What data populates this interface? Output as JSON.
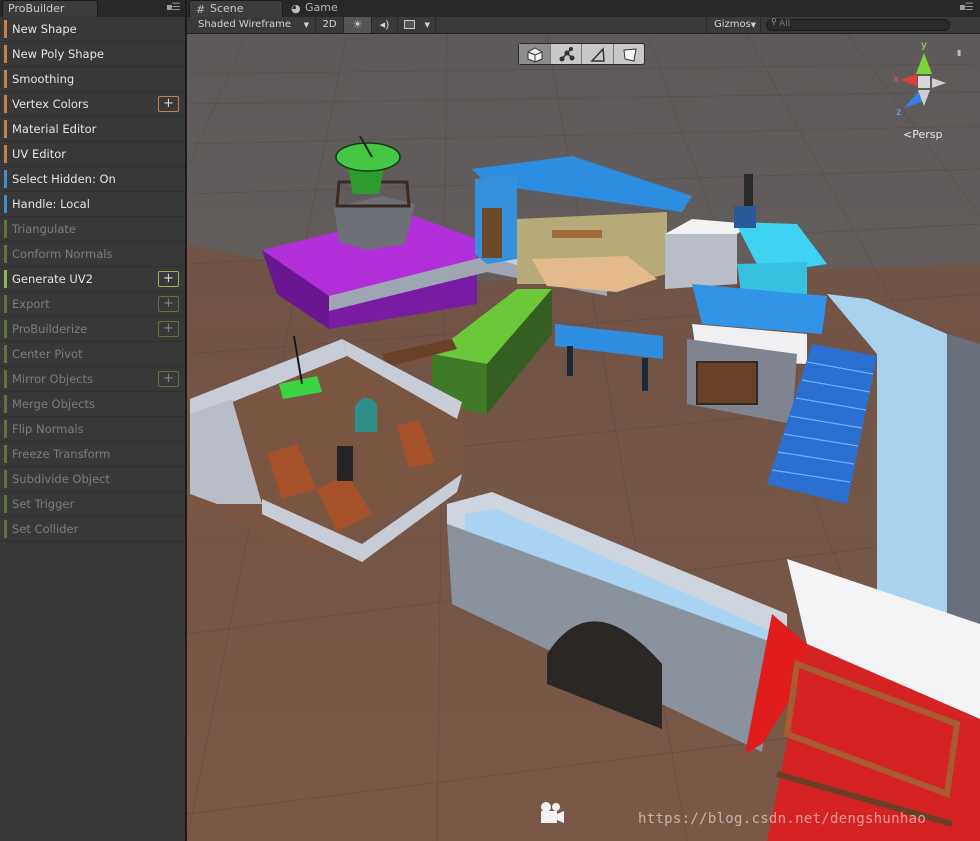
{
  "probuilder": {
    "title": "ProBuilder",
    "items": [
      {
        "label": "New Shape",
        "color": "#c9804a",
        "plus": false,
        "enabled": true
      },
      {
        "label": "New Poly Shape",
        "color": "#c9804a",
        "plus": false,
        "enabled": true
      },
      {
        "label": "Smoothing",
        "color": "#c9804a",
        "plus": false,
        "enabled": true
      },
      {
        "label": "Vertex Colors",
        "color": "#c9804a",
        "plus": true,
        "enabled": true
      },
      {
        "label": "Material Editor",
        "color": "#c9804a",
        "plus": false,
        "enabled": true
      },
      {
        "label": "UV Editor",
        "color": "#c9804a",
        "plus": false,
        "enabled": true
      },
      {
        "label": "Select Hidden: On",
        "color": "#3d8fcf",
        "plus": false,
        "enabled": true
      },
      {
        "label": "Handle: Local",
        "color": "#3d8fcf",
        "plus": false,
        "enabled": true
      },
      {
        "label": "Triangulate",
        "color": "#8fb84e",
        "plus": false,
        "enabled": false
      },
      {
        "label": "Conform Normals",
        "color": "#8fb84e",
        "plus": false,
        "enabled": false
      },
      {
        "label": "Generate UV2",
        "color": "#8fb84e",
        "plus": true,
        "enabled": true
      },
      {
        "label": "Export",
        "color": "#8fb84e",
        "plus": true,
        "enabled": false
      },
      {
        "label": "ProBuilderize",
        "color": "#8fb84e",
        "plus": true,
        "enabled": false
      },
      {
        "label": "Center Pivot",
        "color": "#8fb84e",
        "plus": false,
        "enabled": false
      },
      {
        "label": "Mirror Objects",
        "color": "#8fb84e",
        "plus": true,
        "enabled": false
      },
      {
        "label": "Merge Objects",
        "color": "#8fb84e",
        "plus": false,
        "enabled": false
      },
      {
        "label": "Flip Normals",
        "color": "#8fb84e",
        "plus": false,
        "enabled": false
      },
      {
        "label": "Freeze Transform",
        "color": "#8fb84e",
        "plus": false,
        "enabled": false
      },
      {
        "label": "Subdivide Object",
        "color": "#8fb84e",
        "plus": false,
        "enabled": false
      },
      {
        "label": "Set Trigger",
        "color": "#8fb84e",
        "plus": false,
        "enabled": false
      },
      {
        "label": "Set Collider",
        "color": "#8fb84e",
        "plus": false,
        "enabled": false
      }
    ]
  },
  "tabs": {
    "scene": "Scene",
    "game": "Game"
  },
  "toolbar": {
    "shading_mode": "Shaded Wireframe",
    "mode_2d": "2D",
    "gizmos": "Gizmos",
    "search_placeholder": "All"
  },
  "gizmo": {
    "x_label": "x",
    "y_label": "y",
    "z_label": "z",
    "projection": "Persp"
  },
  "selection_modes": [
    "object-mode",
    "vertex-mode",
    "edge-mode",
    "face-mode"
  ],
  "active_selection_mode": "object-mode",
  "watermark": "https://blog.csdn.net/dengshunhao",
  "colors": {
    "ground": "#7a5440",
    "horizon": "#6b6462",
    "stone": "#c2c9d6",
    "water_blue": "#3a8ad8",
    "roof_blue": "#2f8fe0",
    "purple": "#9a1fbf",
    "green": "#4aa82e",
    "red": "#d82020",
    "wood": "#a45a30"
  }
}
